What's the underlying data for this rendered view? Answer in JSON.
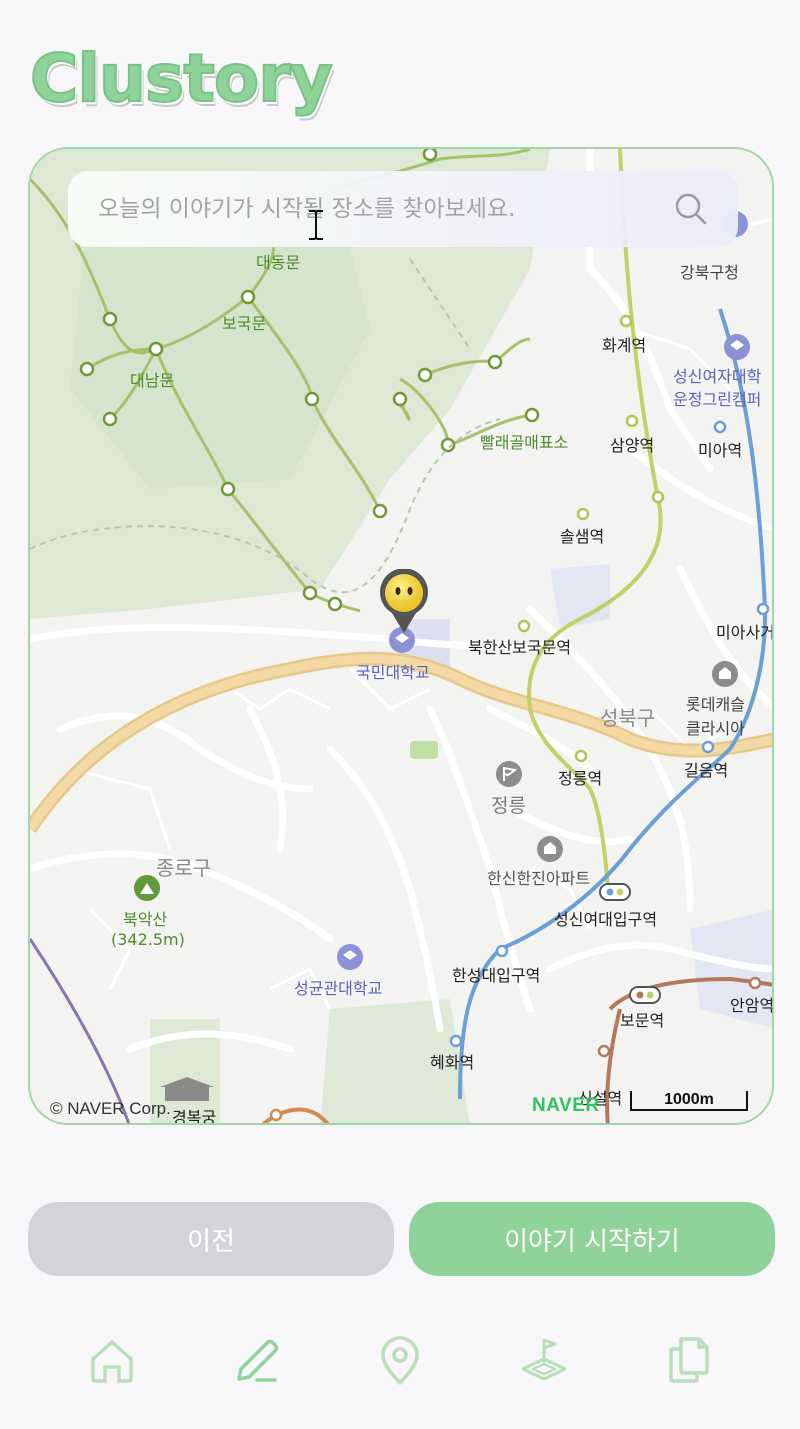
{
  "app": {
    "logo_text": "Clustory"
  },
  "search": {
    "placeholder": "오늘의 이야기가 시작될 장소를 찾아보세요."
  },
  "map": {
    "labels": {
      "daedongmun": "대동문",
      "bogukmun": "보국문",
      "daenammun": "대남문",
      "ppalae": "빨래골매표소",
      "gangbuk_office": "강북구청",
      "hwagye": "화계역",
      "sungshin_uni_1": "성신여자대학",
      "sungshin_uni_2": "운정그린캠퍼",
      "samyang": "삼양역",
      "miya": "미아역",
      "solsaem": "솔샘역",
      "miasa": "미아사거",
      "bukhansan_bogukmun": "북한산보국문역",
      "kookmin": "국민대학교",
      "seongbuk": "성북구",
      "lotte_castle_1": "롯데캐슬",
      "lotte_castle_2": "클라시아",
      "gireum": "길음역",
      "jeongneung_station": "정릉역",
      "jeongneung": "정릉",
      "jongno": "종로구",
      "bugaksan_1": "북악산",
      "bugaksan_2": "(342.5m)",
      "hanshin": "한신한진아파트",
      "sungshin_station": "성신여대입구역",
      "hansung": "한성대입구역",
      "skku": "성균관대학교",
      "anam": "안암역",
      "bomun": "보문역",
      "hyehwa": "혜화역",
      "sinseol": "신설역",
      "gyeongbok": "경복궁"
    },
    "attribution": "© NAVER Corp.",
    "brand": "NAVER",
    "scale_label": "1000m"
  },
  "buttons": {
    "prev": "이전",
    "start": "이야기 시작하기"
  },
  "nav": [
    "home-icon",
    "pencil-icon",
    "location-pin-icon",
    "map-flag-icon",
    "copy-icon"
  ],
  "colors": {
    "accent": "#8fd39a",
    "disabled": "#d3d4da"
  }
}
